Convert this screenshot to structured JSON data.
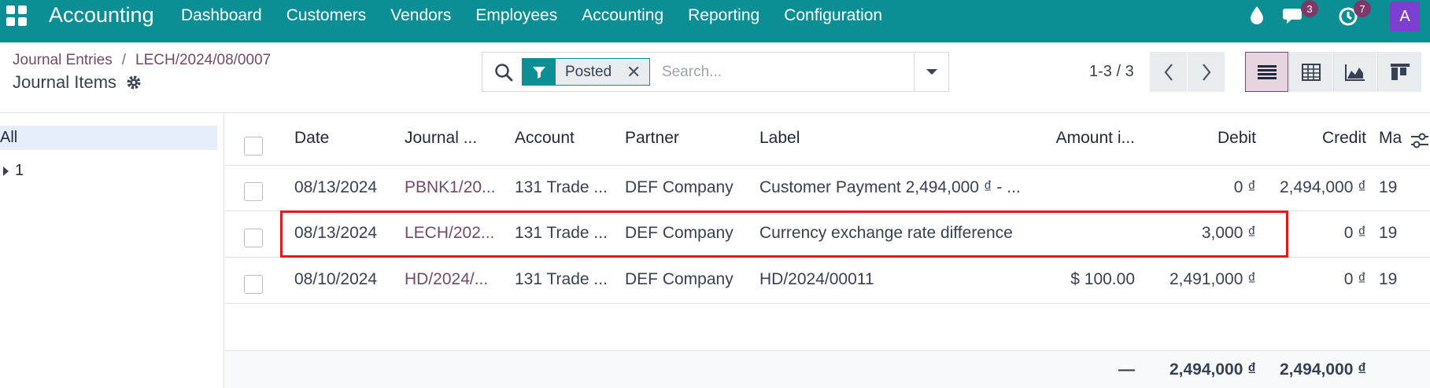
{
  "app": {
    "name": "Accounting",
    "menu": [
      "Dashboard",
      "Customers",
      "Vendors",
      "Employees",
      "Accounting",
      "Reporting",
      "Configuration"
    ]
  },
  "systray": {
    "icons": [
      "droplet-icon",
      "chat-icon",
      "activity-clock-icon"
    ],
    "chat_badge": "3",
    "activity_badge": "7",
    "avatar_letter": "A",
    "accent": "#0b8f94"
  },
  "breadcrumb": {
    "parent": "Journal Entries",
    "separator": "/",
    "record": "LECH/2024/08/0007",
    "current": "Journal Items"
  },
  "search": {
    "facet_label": "Posted",
    "placeholder": "Search..."
  },
  "pager": {
    "text": "1-3 / 3"
  },
  "sidebar": {
    "all_label": "All",
    "group_label": "1"
  },
  "columns": [
    "Date",
    "Journal ...",
    "Account",
    "Partner",
    "Label",
    "Amount i...",
    "Debit",
    "Credit",
    "Ma"
  ],
  "rows": [
    {
      "date": "08/13/2024",
      "journal": "PBNK1/20...",
      "account": "131 Trade ...",
      "partner": "DEF Company",
      "label": "Customer Payment 2,494,000 ₫ - ...",
      "amount_currency": "",
      "debit": "0 ₫",
      "credit": "2,494,000 ₫",
      "matching": "19"
    },
    {
      "date": "08/13/2024",
      "journal": "LECH/202...",
      "account": "131 Trade ...",
      "partner": "DEF Company",
      "label": "Currency exchange rate difference",
      "amount_currency": "",
      "debit": "3,000 ₫",
      "credit": "0 ₫",
      "matching": "19"
    },
    {
      "date": "08/10/2024",
      "journal": "HD/2024/...",
      "account": "131 Trade ...",
      "partner": "DEF Company",
      "label": "HD/2024/00011",
      "amount_currency": "$ 100.00",
      "debit": "2,491,000 ₫",
      "credit": "0 ₫",
      "matching": "19"
    }
  ],
  "totals": {
    "amount_currency": "—",
    "debit": "2,494,000 ₫",
    "credit": "2,494,000 ₫"
  },
  "highlight_color": "#e3161c"
}
